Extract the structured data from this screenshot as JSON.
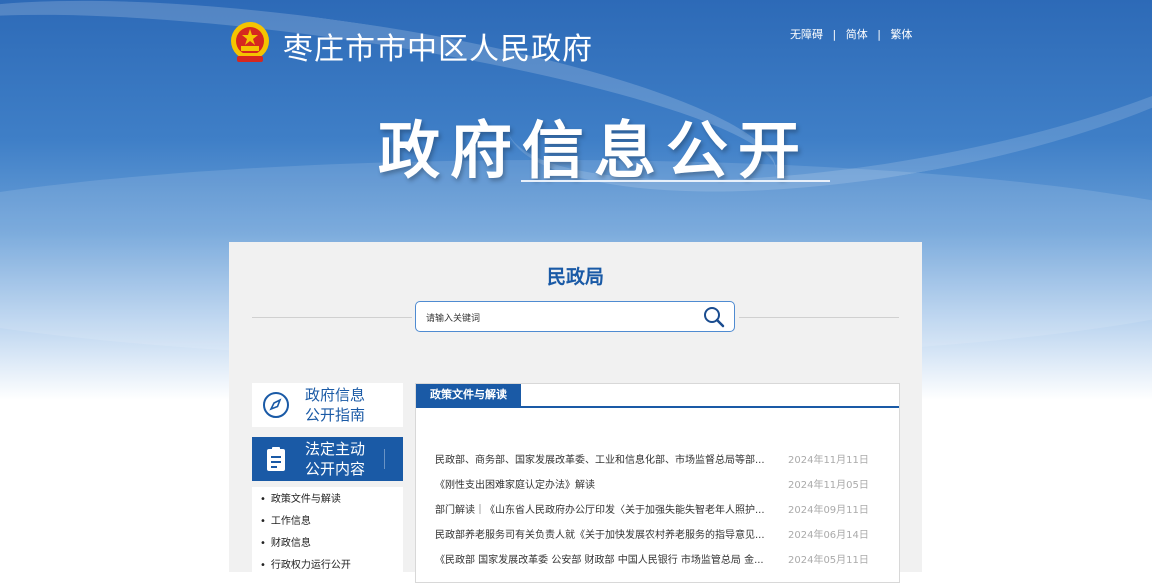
{
  "header": {
    "site_title": "枣庄市市中区人民政府",
    "lang_links": [
      "无障碍",
      "简体",
      "繁体"
    ],
    "separator": "|"
  },
  "banner": {
    "title": "政府信息公开"
  },
  "department": "民政局",
  "search": {
    "placeholder": "请输入关键词"
  },
  "sidebar": {
    "guide": {
      "line1": "政府信息",
      "line2": "公开指南"
    },
    "content": {
      "line1": "法定主动",
      "line2": "公开内容"
    },
    "items": [
      "政策文件与解读",
      "工作信息",
      "财政信息",
      "行政权力运行公开"
    ]
  },
  "main": {
    "tab": "政策文件与解读",
    "rows": [
      {
        "title": "民政部、商务部、国家发展改革委、工业和信息化部、市场监督总局等部...",
        "date": "2024年11月11日"
      },
      {
        "title": "《刚性支出困难家庭认定办法》解读",
        "date": "2024年11月05日"
      },
      {
        "title": "部门解读｜《山东省人民政府办公厅印发〈关于加强失能失智老年人照护...",
        "date": "2024年09月11日"
      },
      {
        "title": "民政部养老服务司有关负责人就《关于加快发展农村养老服务的指导意见...",
        "date": "2024年06月14日"
      },
      {
        "title": "《民政部 国家发展改革委 公安部 财政部 中国人民银行 市场监管总局 金...",
        "date": "2024年05月11日"
      }
    ]
  },
  "colors": {
    "primary": "#1a5aa6",
    "date": "#aaaaaa",
    "panel_bg": "#f1f1f1"
  },
  "icons": [
    "national-emblem-icon",
    "search-icon",
    "compass-icon",
    "clipboard-icon"
  ]
}
